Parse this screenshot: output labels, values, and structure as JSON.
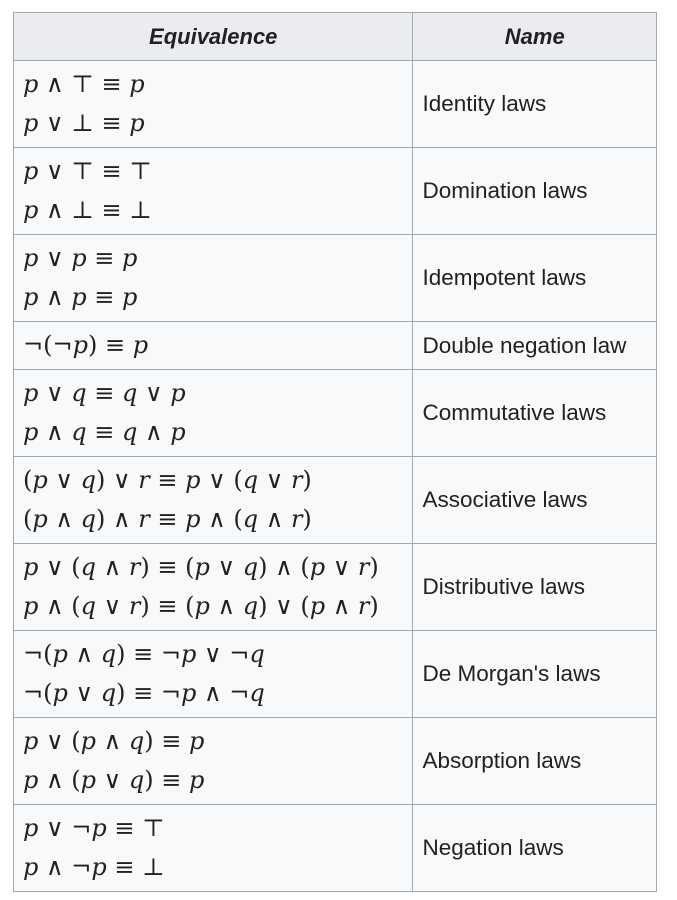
{
  "table": {
    "headers": {
      "equivalence": "Equivalence",
      "name": "Name"
    },
    "rows": [
      {
        "equivalences": [
          "p ∧ ⊤ ≡ p",
          "p ∨ ⊥ ≡ p"
        ],
        "name": "Identity laws"
      },
      {
        "equivalences": [
          "p ∨ ⊤ ≡ ⊤",
          "p ∧ ⊥ ≡ ⊥"
        ],
        "name": "Domination laws"
      },
      {
        "equivalences": [
          "p ∨ p ≡ p",
          "p ∧ p ≡ p"
        ],
        "name": "Idempotent laws"
      },
      {
        "equivalences": [
          "¬(¬p) ≡ p"
        ],
        "name": "Double negation law"
      },
      {
        "equivalences": [
          "p ∨ q ≡ q ∨ p",
          "p ∧ q ≡ q ∧ p"
        ],
        "name": "Commutative laws"
      },
      {
        "equivalences": [
          "(p ∨ q) ∨ r ≡ p ∨ (q ∨ r)",
          "(p ∧ q) ∧ r ≡ p ∧ (q ∧ r)"
        ],
        "name": "Associative laws"
      },
      {
        "equivalences": [
          "p ∨ (q ∧ r) ≡ (p ∨ q) ∧ (p ∨ r)",
          "p ∧ (q ∨ r) ≡ (p ∧ q) ∨ (p ∧ r)"
        ],
        "name": "Distributive laws"
      },
      {
        "equivalences": [
          "¬(p ∧ q) ≡ ¬p ∨ ¬q",
          "¬(p ∨ q) ≡ ¬p ∧ ¬q"
        ],
        "name": "De Morgan's laws"
      },
      {
        "equivalences": [
          "p ∨ (p ∧ q) ≡ p",
          "p ∧ (p ∨ q) ≡ p"
        ],
        "name": "Absorption laws"
      },
      {
        "equivalences": [
          "p ∨ ¬p ≡ ⊤",
          "p ∧ ¬p ≡ ⊥"
        ],
        "name": "Negation laws"
      }
    ]
  },
  "colors": {
    "header_bg": "#eaecf0",
    "cell_bg": "#f8f9fa",
    "border": "#a2a9b1",
    "text": "#202122"
  }
}
